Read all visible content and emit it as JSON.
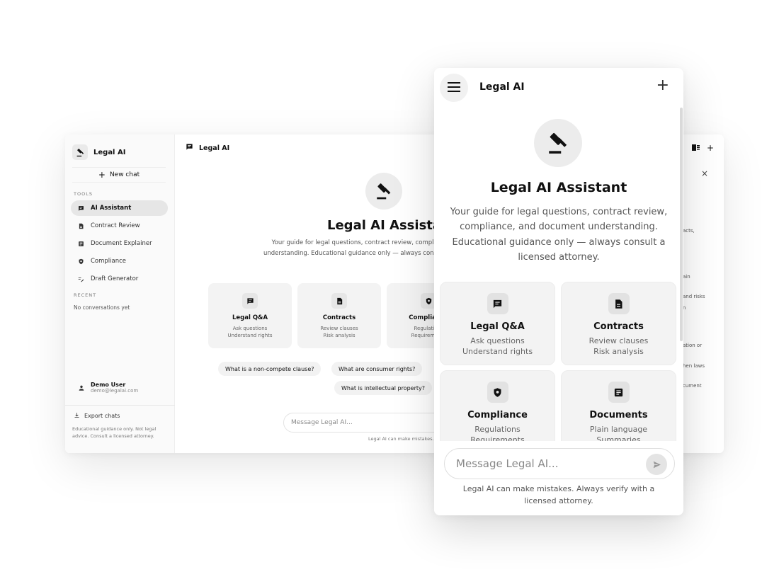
{
  "desktop": {
    "sidebar": {
      "brand": "Legal AI",
      "new_chat": "New chat",
      "tools_heading": "TOOLS",
      "items": [
        {
          "label": "AI Assistant",
          "icon": "chat-icon",
          "active": true
        },
        {
          "label": "Contract Review",
          "icon": "document-icon"
        },
        {
          "label": "Document Explainer",
          "icon": "article-icon"
        },
        {
          "label": "Compliance",
          "icon": "shield-icon"
        },
        {
          "label": "Draft Generator",
          "icon": "draft-icon"
        }
      ],
      "recent_heading": "RECENT",
      "recent_empty": "No conversations yet",
      "user_name": "Demo User",
      "user_email": "demo@legalai.com",
      "export": "Export chats",
      "disclaimer": "Educational guidance only. Not legal advice. Consult a licensed attorney."
    },
    "header_title": "Legal AI",
    "header_close": "×",
    "header_plus": "+",
    "title": "Legal AI Assistant",
    "subtitle": "Your guide for legal questions, contract review, compliance, and document understanding. Educational guidance only — always consult a licensed attorney.",
    "cards": [
      {
        "title": "Legal Q&A",
        "line1": "Ask questions",
        "line2": "Understand rights",
        "icon": "chat-icon"
      },
      {
        "title": "Contracts",
        "line1": "Review clauses",
        "line2": "Risk analysis",
        "icon": "document-icon"
      },
      {
        "title": "Compliance",
        "line1": "Regulations",
        "line2": "Requirements",
        "icon": "shield-icon"
      }
    ],
    "chips": [
      "What is a non-compete clause?",
      "What are consumer rights?",
      "What is intellectual property?"
    ],
    "input_placeholder": "Message Legal AI...",
    "footnote": "Legal AI can make mistakes. Always verify with a licensed attorney.",
    "right_snippets": [
      "acts,",
      "ain",
      "and risks",
      "n",
      "ation or",
      "hen laws",
      "cument"
    ]
  },
  "mobile": {
    "title": "Legal AI",
    "plus": "+",
    "heading": "Legal AI Assistant",
    "subtitle": "Your guide for legal questions, contract review, compliance, and document understanding. Educational guidance only — always consult a licensed attorney.",
    "cards": [
      {
        "title": "Legal Q&A",
        "line1": "Ask questions",
        "line2": "Understand rights",
        "icon": "chat-icon"
      },
      {
        "title": "Contracts",
        "line1": "Review clauses",
        "line2": "Risk analysis",
        "icon": "document-icon"
      },
      {
        "title": "Compliance",
        "line1": "Regulations",
        "line2": "Requirements",
        "icon": "shield-icon"
      },
      {
        "title": "Documents",
        "line1": "Plain language",
        "line2": "Summaries",
        "icon": "article-icon"
      }
    ],
    "input_placeholder": "Message Legal AI...",
    "disclaimer": "Legal AI can make mistakes. Always verify with a licensed attorney."
  },
  "colors": {
    "accent": "#111111",
    "card_bg": "#f3f3f3",
    "muted": "#555555"
  }
}
